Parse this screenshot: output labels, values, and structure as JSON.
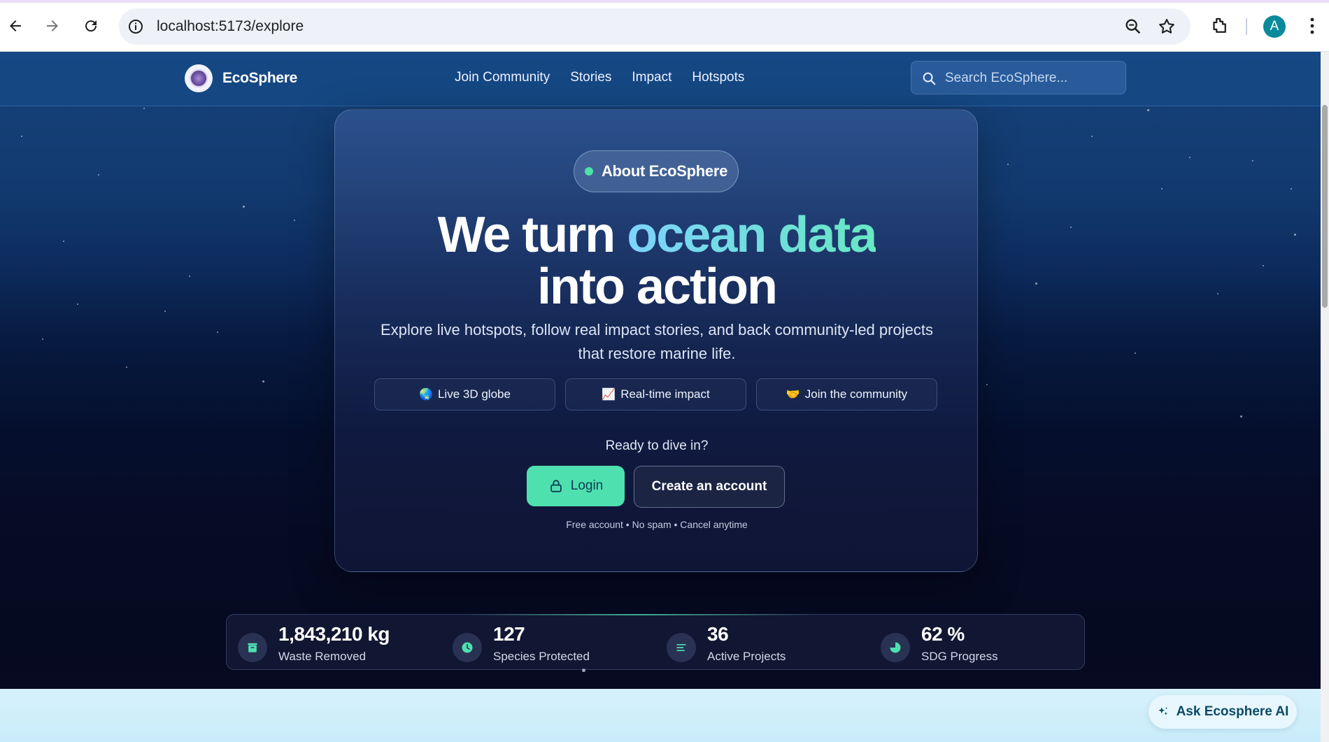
{
  "browser": {
    "url_host": "localhost:5173/explore",
    "avatar_letter": "A",
    "icons": [
      "back-arrow-icon",
      "forward-arrow-icon",
      "reload-icon",
      "site-info-icon",
      "zoom-icon",
      "bookmark-star-icon",
      "extensions-icon",
      "menu-kebab-icon"
    ]
  },
  "site_nav": {
    "brand": "EcoSphere",
    "links": [
      "Join Community",
      "Stories",
      "Impact",
      "Hotspots"
    ],
    "search_placeholder": "Search EcoSphere..."
  },
  "hero": {
    "pill_label": "About EcoSphere",
    "headline_part1": "We turn ",
    "headline_highlight": "ocean data",
    "headline_part2": "into action",
    "subtitle": "Explore live hotspots, follow real impact stories, and back community-led projects that restore marine life.",
    "chips": [
      {
        "emoji": "🌏",
        "label": "Live 3D globe"
      },
      {
        "emoji": "📈",
        "label": "Real-time impact"
      },
      {
        "emoji": "🤝",
        "label": "Join the community"
      }
    ],
    "ready_text": "Ready to dive in?",
    "login_label": "Login",
    "create_account_label": "Create an account",
    "fineprint": "Free account • No spam • Cancel anytime"
  },
  "stats": [
    {
      "icon": "trash-icon",
      "value": "1,843,210 kg",
      "label": "Waste Removed"
    },
    {
      "icon": "clock-icon",
      "value": "127",
      "label": "Species Protected"
    },
    {
      "icon": "list-icon",
      "value": "36",
      "label": "Active Projects"
    },
    {
      "icon": "pie-chart-icon",
      "value": "62 %",
      "label": "SDG Progress"
    }
  ],
  "ask_ai_label": "Ask Ecosphere AI",
  "colors": {
    "accent_green": "#4fe0b0",
    "nav_blue": "#164c8c",
    "deep_navy": "#070a1f",
    "headline_gradient_start": "#7dd3fc",
    "headline_gradient_end": "#67e8c3"
  }
}
